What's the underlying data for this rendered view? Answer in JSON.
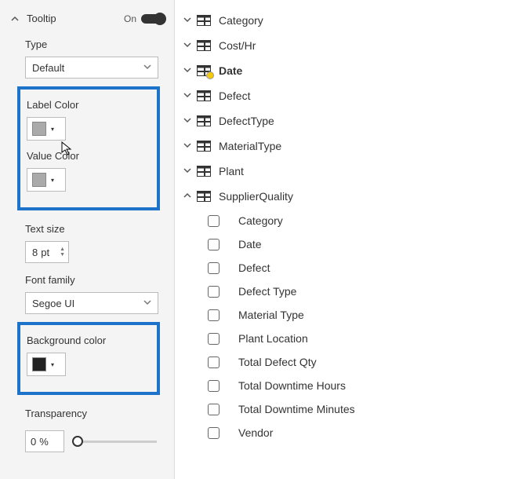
{
  "tooltip": {
    "section_title": "Tooltip",
    "toggle_state": "On",
    "type_label": "Type",
    "type_value": "Default",
    "label_color_label": "Label Color",
    "value_color_label": "Value Color",
    "text_size_label": "Text size",
    "text_size_value": "8",
    "text_size_unit": "pt",
    "font_family_label": "Font family",
    "font_family_value": "Segoe UI",
    "background_color_label": "Background color",
    "transparency_label": "Transparency",
    "transparency_value": "0",
    "transparency_unit": "%",
    "colors": {
      "label_color": "#aaaaaa",
      "value_color": "#aaaaaa",
      "background_color": "#222222"
    }
  },
  "fields": {
    "tables": [
      {
        "name": "Category",
        "expanded": false,
        "bold": false,
        "badge": false
      },
      {
        "name": "Cost/Hr",
        "expanded": false,
        "bold": false,
        "badge": false
      },
      {
        "name": "Date",
        "expanded": false,
        "bold": true,
        "badge": true
      },
      {
        "name": "Defect",
        "expanded": false,
        "bold": false,
        "badge": false
      },
      {
        "name": "DefectType",
        "expanded": false,
        "bold": false,
        "badge": false
      },
      {
        "name": "MaterialType",
        "expanded": false,
        "bold": false,
        "badge": false
      },
      {
        "name": "Plant",
        "expanded": false,
        "bold": false,
        "badge": false
      },
      {
        "name": "SupplierQuality",
        "expanded": true,
        "bold": false,
        "badge": false
      }
    ],
    "supplier_quality_fields": [
      "Category",
      "Date",
      "Defect",
      "Defect Type",
      "Material Type",
      "Plant Location",
      "Total Defect Qty",
      "Total Downtime Hours",
      "Total Downtime Minutes",
      "Vendor"
    ]
  }
}
